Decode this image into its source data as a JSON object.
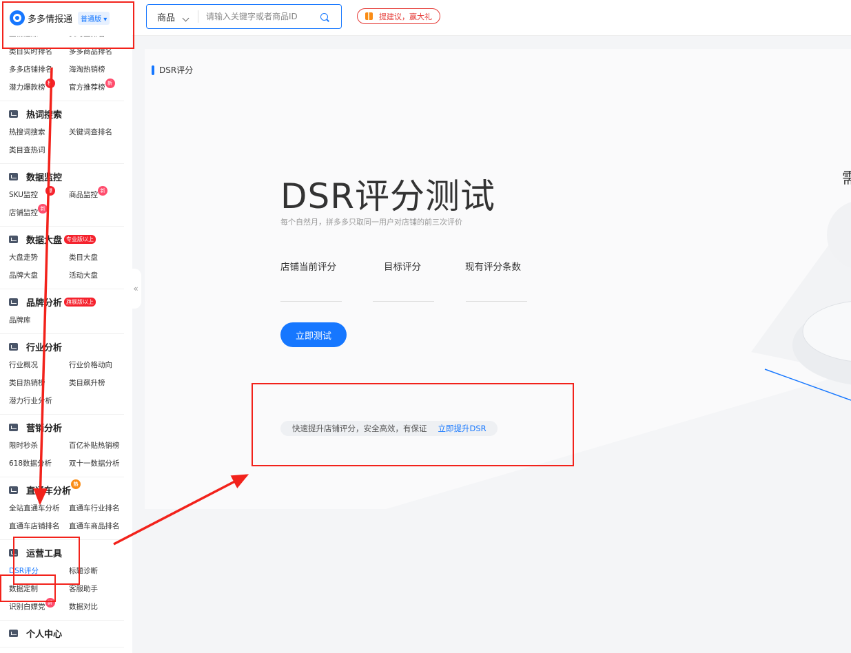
{
  "logo": {
    "name": "多多情报通",
    "edition": "普通版"
  },
  "header": {
    "search_category": "商品",
    "search_placeholder": "请输入关键字或者商品ID",
    "suggest_label": "提建议，赢大礼"
  },
  "sidebar": {
    "top_partial": [
      "上榜追踪",
      "实时查排名"
    ],
    "top_items": [
      {
        "label": "类目实时排名"
      },
      {
        "label": "多多商品排名"
      },
      {
        "label": "多多店铺排名"
      },
      {
        "label": "海淘热销榜"
      },
      {
        "label": "潜力爆款榜",
        "badge": "榜"
      },
      {
        "label": "官方推荐榜",
        "badge": "新"
      }
    ],
    "groups": [
      {
        "title": "热词搜索",
        "items": [
          {
            "label": "热搜词搜索"
          },
          {
            "label": "关键词查排名"
          },
          {
            "label": "类目查热词"
          }
        ]
      },
      {
        "title": "数据监控",
        "items": [
          {
            "label": "SKU监控",
            "badge": "爆"
          },
          {
            "label": "商品监控",
            "badge": "新"
          },
          {
            "label": "店铺监控",
            "badge": "新"
          }
        ]
      },
      {
        "title": "数据大盘",
        "tag": "专业版以上",
        "items": [
          {
            "label": "大盘走势"
          },
          {
            "label": "类目大盘"
          },
          {
            "label": "品牌大盘"
          },
          {
            "label": "活动大盘"
          }
        ]
      },
      {
        "title": "品牌分析",
        "tag": "旗舰版以上",
        "items": [
          {
            "label": "品牌库"
          }
        ]
      },
      {
        "title": "行业分析",
        "items": [
          {
            "label": "行业概况"
          },
          {
            "label": "行业价格动向"
          },
          {
            "label": "类目热销榜"
          },
          {
            "label": "类目飙升榜"
          },
          {
            "label": "潜力行业分析"
          }
        ]
      },
      {
        "title": "营销分析",
        "items": [
          {
            "label": "限时秒杀"
          },
          {
            "label": "百亿补贴热销榜"
          },
          {
            "label": "618数据分析"
          },
          {
            "label": "双十一数据分析"
          }
        ]
      },
      {
        "title": "直通车分析",
        "badge": "热",
        "items": [
          {
            "label": "全站直通车分析"
          },
          {
            "label": "直通车行业排名"
          },
          {
            "label": "直通车店铺排名"
          },
          {
            "label": "直通车商品排名"
          }
        ]
      },
      {
        "title": "运营工具",
        "items": [
          {
            "label": "DSR评分",
            "active": true
          },
          {
            "label": "标题诊断"
          },
          {
            "label": "数据定制"
          },
          {
            "label": "客服助手"
          },
          {
            "label": "识别白嫖党",
            "badge": "新"
          },
          {
            "label": "数据对比"
          }
        ]
      },
      {
        "title": "个人中心",
        "items": []
      }
    ]
  },
  "page": {
    "section_title": "DSR评分",
    "hero_title": "DSR评分测试",
    "hero_subtitle": "每个自然月，拼多多只取同一用户对店铺的前三次评价",
    "fields": [
      "店铺当前评分",
      "目标评分",
      "现有评分条数"
    ],
    "test_button": "立即测试",
    "promo_text": "快速提升店铺评分，安全高效，有保证",
    "promo_link": "立即提升DSR",
    "right_partial": "需"
  },
  "colors": {
    "accent": "#1677ff",
    "annotation": "#f2221b"
  }
}
